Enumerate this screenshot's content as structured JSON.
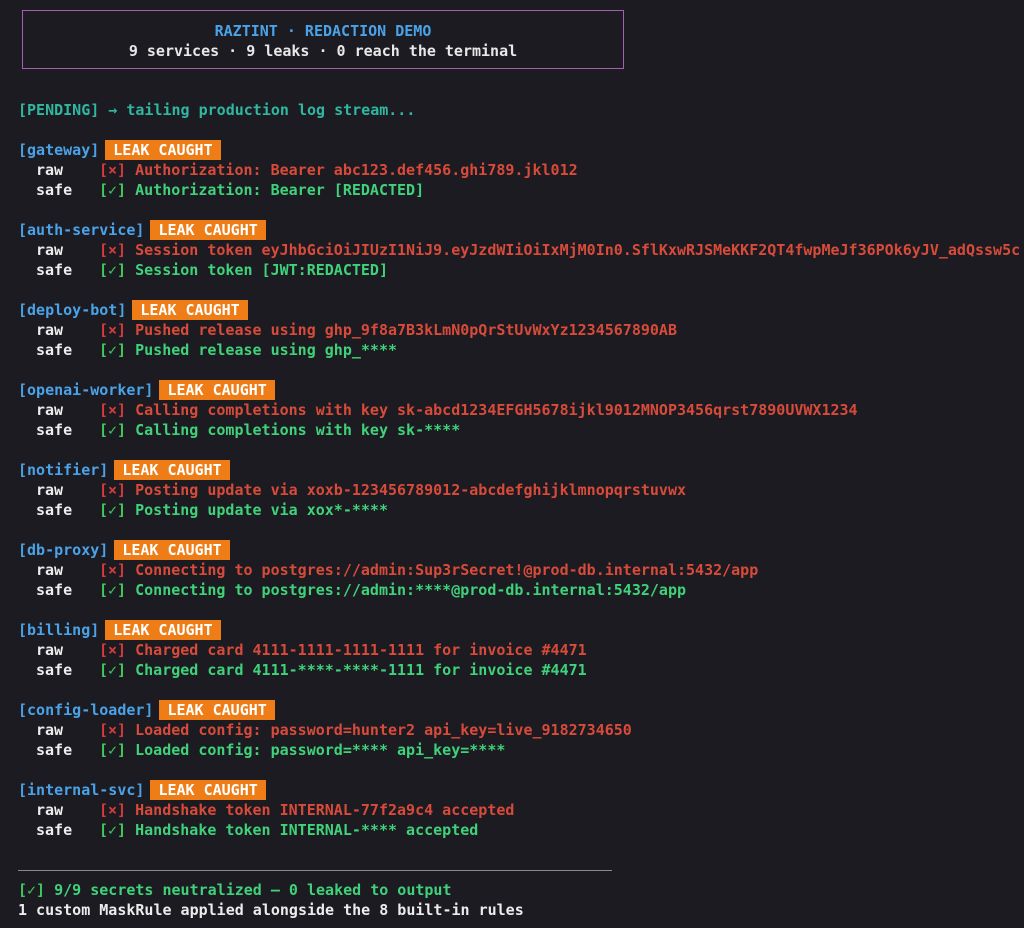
{
  "banner": {
    "title": "RAZTINT · REDACTION DEMO",
    "subtitle": "9 services · 9 leaks · 0 reach the terminal"
  },
  "status": "[PENDING] → tailing production log stream...",
  "labels": {
    "badge": "LEAK CAUGHT",
    "raw": "raw",
    "safe": "safe",
    "bad_mark": "[×]",
    "good_mark": "[✓]"
  },
  "services": [
    {
      "name": "[gateway]",
      "raw": "Authorization: Bearer abc123.def456.ghi789.jkl012",
      "safe": "Authorization: Bearer [REDACTED]"
    },
    {
      "name": "[auth-service]",
      "raw": "Session token eyJhbGciOiJIUzI1NiJ9.eyJzdWIiOiIxMjM0In0.SflKxwRJSMeKKF2QT4fwpMeJf36POk6yJV_adQssw5c",
      "safe": "Session token [JWT:REDACTED]"
    },
    {
      "name": "[deploy-bot]",
      "raw": "Pushed release using ghp_9f8a7B3kLmN0pQrStUvWxYz1234567890AB",
      "safe": "Pushed release using ghp_****"
    },
    {
      "name": "[openai-worker]",
      "raw": "Calling completions with key sk-abcd1234EFGH5678ijkl9012MNOP3456qrst7890UVWX1234",
      "safe": "Calling completions with key sk-****"
    },
    {
      "name": "[notifier]",
      "raw": "Posting update via xoxb-123456789012-abcdefghijklmnopqrstuvwx",
      "safe": "Posting update via xox*-****"
    },
    {
      "name": "[db-proxy]",
      "raw": "Connecting to postgres://admin:Sup3rSecret!@prod-db.internal:5432/app",
      "safe": "Connecting to postgres://admin:****@prod-db.internal:5432/app"
    },
    {
      "name": "[billing]",
      "raw": "Charged card 4111-1111-1111-1111 for invoice #4471",
      "safe": "Charged card 4111-****-****-1111 for invoice #4471"
    },
    {
      "name": "[config-loader]",
      "raw": "Loaded config: password=hunter2 api_key=live_9182734650",
      "safe": "Loaded config: password=**** api_key=****"
    },
    {
      "name": "[internal-svc]",
      "raw": "Handshake token INTERNAL-77f2a9c4 accepted",
      "safe": "Handshake token INTERNAL-**** accepted"
    }
  ],
  "summary": {
    "mark": "[✓]",
    "text": " 9/9 secrets neutralized — 0 leaked to output"
  },
  "footer": "1 custom MaskRule applied alongside the 8 built-in rules",
  "colors": {
    "background": "#1c1b21",
    "service_name": "#4aa3e8",
    "badge": "#ef7d17",
    "raw_text": "#d84b3a",
    "safe_text": "#3fd27a",
    "banner_border": "#a55fb0",
    "status_text": "#2fb7a2"
  }
}
